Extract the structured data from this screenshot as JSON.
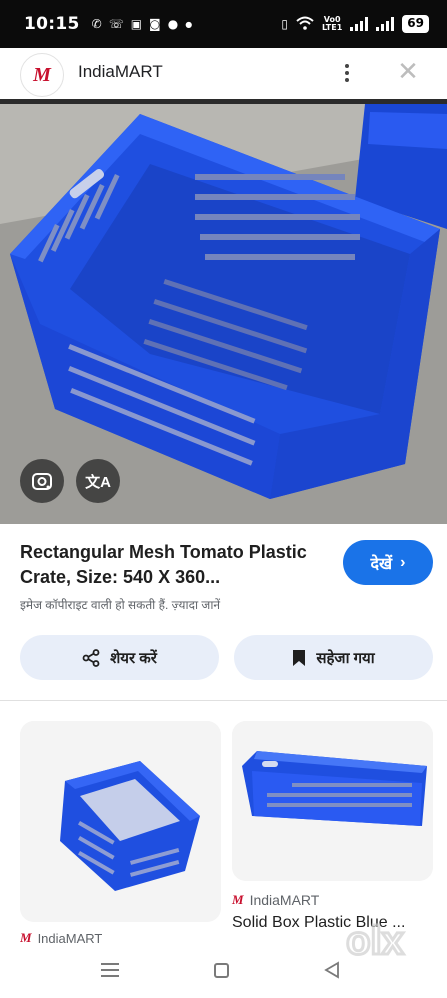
{
  "status_bar": {
    "time": "10:15",
    "left_icons": [
      "whatsapp-icon",
      "call-icon",
      "gallery-icon",
      "photo-icon",
      "message-icon",
      "dot-icon"
    ],
    "volte_top": "Vo0",
    "volte_bottom": "LTE1",
    "battery": "69"
  },
  "app_bar": {
    "logo_text": "M",
    "site_name": "IndiaMART"
  },
  "result": {
    "title": "Rectangular Mesh Tomato Plastic Crate, Size: 540 X 360...",
    "visit_label": "देखें",
    "copyright_note": "इमेज कॉपीराइट वाली हो सकती हैं. ज़्यादा जानें",
    "share_label": "शेयर करें",
    "saved_label": "सहेजा गया",
    "translate_glyph": "文A"
  },
  "related": [
    {
      "source": "IndiaMART",
      "title": ""
    },
    {
      "source": "IndiaMART",
      "title": "Solid Box Plastic Blue ..."
    }
  ],
  "watermark": "olx",
  "colors": {
    "accent": "#1a73e8",
    "crate_blue": "#1f4fe0",
    "chip_bg": "#e8eef9"
  }
}
